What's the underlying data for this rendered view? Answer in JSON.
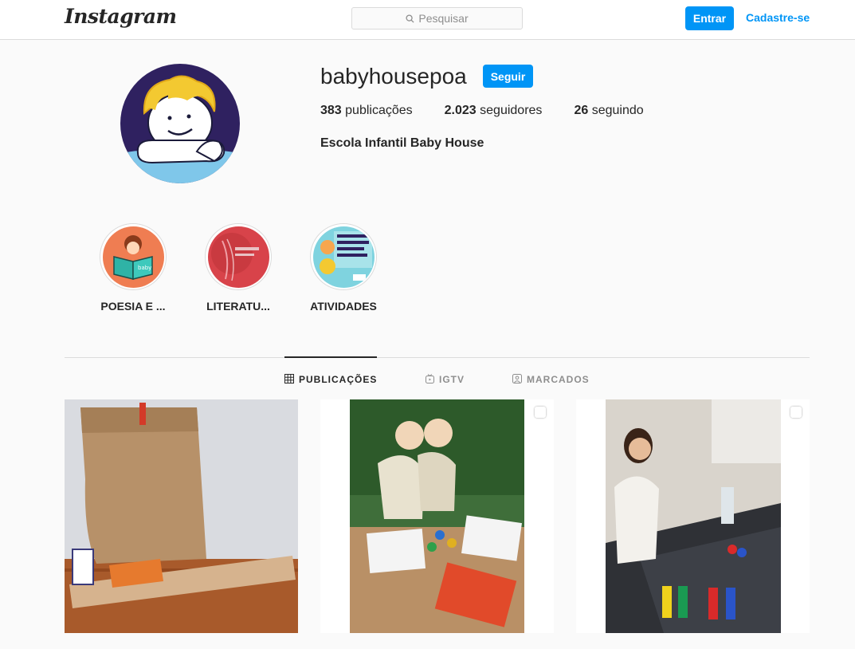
{
  "nav": {
    "logo": "Instagram",
    "search_placeholder": "Pesquisar",
    "login_label": "Entrar",
    "signup_label": "Cadastre-se"
  },
  "profile": {
    "username": "babyhousepoa",
    "follow_label": "Seguir",
    "posts_count": "383",
    "posts_label": "publicações",
    "followers_count": "2.023",
    "followers_label": "seguidores",
    "following_count": "26",
    "following_label": "seguindo",
    "full_name": "Escola Infantil Baby House"
  },
  "highlights": [
    {
      "label": "POESIA E ..."
    },
    {
      "label": "LITERATU..."
    },
    {
      "label": "ATIVIDADES"
    }
  ],
  "tabs": [
    {
      "label": "PUBLICAÇÕES",
      "icon": "grid-icon",
      "active": true
    },
    {
      "label": "IGTV",
      "icon": "igtv-icon",
      "active": false
    },
    {
      "label": "MARCADOS",
      "icon": "tagged-icon",
      "active": false
    }
  ],
  "posts": [
    {
      "type": "photo",
      "multi": false
    },
    {
      "type": "photo",
      "multi": true
    },
    {
      "type": "photo",
      "multi": true
    }
  ],
  "colors": {
    "accent": "#0095f6",
    "text": "#262626",
    "muted": "#8e8e8e",
    "border": "#dbdbdb",
    "background": "#fafafa"
  }
}
